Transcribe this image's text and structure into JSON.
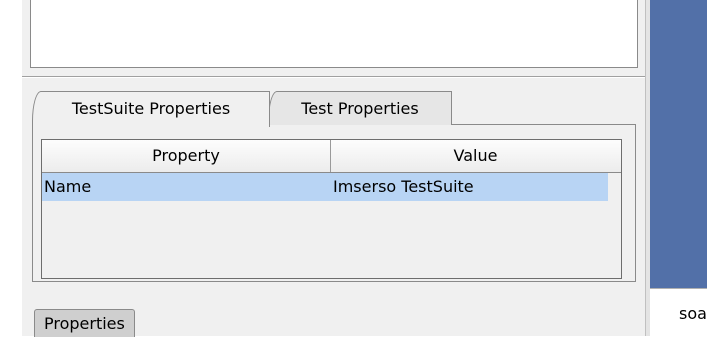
{
  "tabs": [
    {
      "label": "TestSuite Properties",
      "active": true
    },
    {
      "label": "Test Properties",
      "active": false
    }
  ],
  "table": {
    "headers": [
      "Property",
      "Value"
    ],
    "rows": [
      {
        "property": "Name",
        "value": "Imserso TestSuite",
        "selected": true
      }
    ]
  },
  "bottom_tab": {
    "label": "Properties"
  },
  "right_panel": {
    "text": "soa"
  },
  "colors": {
    "selection": "#b8d4f4",
    "right_panel": "#5270a8",
    "panel_bg": "#f0f0f0"
  }
}
